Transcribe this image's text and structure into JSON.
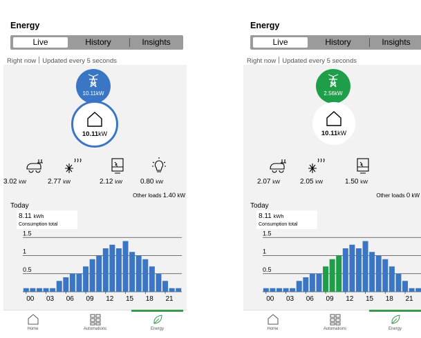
{
  "panels": [
    {
      "id": "left",
      "title": "Energy",
      "tabs": [
        "Live",
        "History",
        "Insights"
      ],
      "status_text": "Right now",
      "update_text": "Updated every 5 seconds",
      "grid": {
        "value": "10.11",
        "unit": "kW",
        "color": "#3a76c4"
      },
      "home": {
        "value": "10.11",
        "unit": "kW",
        "ring_color": "#3a76c4"
      },
      "devices": [
        {
          "icon": "ev-charger-icon",
          "value": "3.02",
          "unit": "kW"
        },
        {
          "icon": "air-conditioner-icon",
          "value": "2.77",
          "unit": "kW"
        },
        {
          "icon": "water-heater-icon",
          "value": "2.12",
          "unit": "kW"
        },
        {
          "icon": "light-bulb-icon",
          "value": "0.80",
          "unit": "kW"
        }
      ],
      "other_loads": {
        "label": "Other loads",
        "value": "1.40",
        "unit": "kW"
      },
      "today_label": "Today",
      "consumption": {
        "value": "8.11",
        "unit": "kWh",
        "label": "Consumption total"
      },
      "nav": [
        {
          "label": "Home",
          "icon": "home-icon"
        },
        {
          "label": "Automations",
          "icon": "automations-icon"
        },
        {
          "label": "Energy",
          "icon": "leaf-icon",
          "active": true
        }
      ]
    },
    {
      "id": "right",
      "title": "Energy",
      "tabs": [
        "Live",
        "History",
        "Insights"
      ],
      "status_text": "Right now",
      "update_text": "Updated every 5 seconds",
      "grid": {
        "value": "2.56",
        "unit": "kW",
        "color": "#1f9e4a"
      },
      "home": {
        "value": "10.11",
        "unit": "kW",
        "ring_color": ""
      },
      "devices": [
        {
          "icon": "ev-charger-icon",
          "value": "2.07",
          "unit": "kW"
        },
        {
          "icon": "air-conditioner-icon",
          "value": "2.05",
          "unit": "kW"
        },
        {
          "icon": "water-heater-icon",
          "value": "1.50",
          "unit": "kW"
        }
      ],
      "other_loads": {
        "label": "Other loads",
        "value": "0",
        "unit": "kW"
      },
      "today_label": "Today",
      "consumption": {
        "value": "8.11",
        "unit": "kWh",
        "label": "Consumption total"
      },
      "nav": [
        {
          "label": "Home",
          "icon": "home-icon"
        },
        {
          "label": "Automations",
          "icon": "automations-icon"
        },
        {
          "label": "Energy",
          "icon": "leaf-icon",
          "active": true
        }
      ]
    }
  ],
  "chart_data": [
    {
      "type": "bar",
      "x": [
        "00",
        "01",
        "02",
        "03",
        "04",
        "05",
        "06",
        "07",
        "08",
        "09",
        "10",
        "11",
        "12",
        "13",
        "14",
        "15",
        "16",
        "17",
        "18",
        "19",
        "20",
        "21",
        "22",
        "23"
      ],
      "x_ticks": [
        "00",
        "03",
        "06",
        "09",
        "12",
        "15",
        "18",
        "21"
      ],
      "values": [
        0.1,
        0.1,
        0.1,
        0.1,
        0.1,
        0.3,
        0.4,
        0.5,
        0.5,
        0.7,
        0.9,
        1.0,
        1.2,
        1.3,
        1.2,
        1.4,
        1.1,
        1.0,
        0.9,
        0.7,
        0.5,
        0.3,
        0.1,
        0.1
      ],
      "bar_color": "#3a76c4",
      "ylim": [
        0,
        1.6
      ],
      "y_ticks": [
        "0.5",
        "1",
        "1.5"
      ],
      "grid": true
    },
    {
      "type": "bar",
      "x": [
        "00",
        "01",
        "02",
        "03",
        "04",
        "05",
        "06",
        "07",
        "08",
        "09",
        "10",
        "11",
        "12",
        "13",
        "14",
        "15",
        "16",
        "17",
        "18",
        "19",
        "20",
        "21",
        "22",
        "23"
      ],
      "x_ticks": [
        "00",
        "03",
        "06",
        "09",
        "12",
        "15",
        "18",
        "21"
      ],
      "values": [
        0.1,
        0.1,
        0.1,
        0.1,
        0.1,
        0.3,
        0.4,
        0.5,
        0.5,
        0.7,
        0.9,
        1.0,
        1.2,
        1.3,
        1.2,
        1.4,
        1.1,
        1.0,
        0.9,
        0.7,
        0.5,
        0.3,
        0.1,
        0.1
      ],
      "bar_color": "#3a76c4",
      "solar_color": "#1f9e4a",
      "solar_hours": [
        "09",
        "10",
        "11"
      ],
      "ylim": [
        0,
        1.6
      ],
      "y_ticks": [
        "0.5",
        "1",
        "1.5"
      ],
      "grid": true
    }
  ]
}
